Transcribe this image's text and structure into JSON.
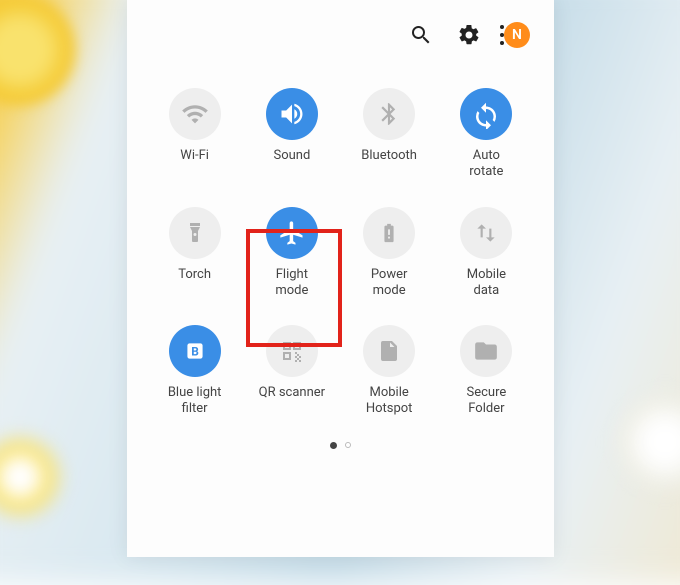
{
  "topbar": {
    "avatar_letter": "N"
  },
  "toggles": [
    {
      "id": "wifi",
      "label": "Wi-Fi",
      "icon": "wifi-icon",
      "active": false,
      "highlighted": false
    },
    {
      "id": "sound",
      "label": "Sound",
      "icon": "sound-icon",
      "active": true,
      "highlighted": false
    },
    {
      "id": "bluetooth",
      "label": "Bluetooth",
      "icon": "bluetooth-icon",
      "active": false,
      "highlighted": false
    },
    {
      "id": "autorotate",
      "label": "Auto\nrotate",
      "icon": "rotate-icon",
      "active": true,
      "highlighted": false
    },
    {
      "id": "torch",
      "label": "Torch",
      "icon": "torch-icon",
      "active": false,
      "highlighted": false
    },
    {
      "id": "flight",
      "label": "Flight\nmode",
      "icon": "airplane-icon",
      "active": true,
      "highlighted": true
    },
    {
      "id": "power",
      "label": "Power\nmode",
      "icon": "battery-icon",
      "active": false,
      "highlighted": false
    },
    {
      "id": "mobiledata",
      "label": "Mobile\ndata",
      "icon": "data-icon",
      "active": false,
      "highlighted": false
    },
    {
      "id": "bluelight",
      "label": "Blue light\nfilter",
      "icon": "bluelight-icon",
      "active": true,
      "highlighted": false
    },
    {
      "id": "qr",
      "label": "QR scanner",
      "icon": "qr-icon",
      "active": false,
      "highlighted": false
    },
    {
      "id": "hotspot",
      "label": "Mobile\nHotspot",
      "icon": "hotspot-icon",
      "active": false,
      "highlighted": false
    },
    {
      "id": "secure",
      "label": "Secure\nFolder",
      "icon": "folder-icon",
      "active": false,
      "highlighted": false
    }
  ],
  "pager": {
    "pages": 2,
    "current": 0
  }
}
